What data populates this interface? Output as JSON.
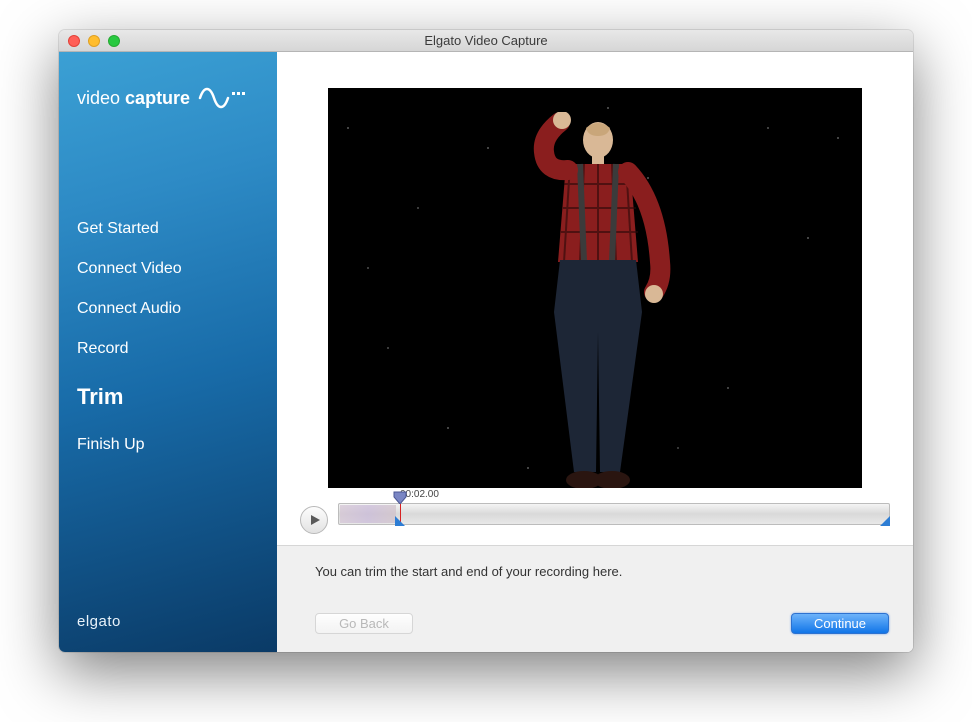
{
  "window": {
    "title": "Elgato Video Capture"
  },
  "logo": {
    "word1": "video",
    "word2": "capture"
  },
  "steps": {
    "s1": "Get Started",
    "s2": "Connect Video",
    "s3": "Connect Audio",
    "s4": "Record",
    "s5": "Trim",
    "s6": "Finish Up",
    "active": "s5"
  },
  "brand": "elgato",
  "timeline": {
    "timecode": "00:02.00"
  },
  "help": "You can trim the start and end of your recording here.",
  "buttons": {
    "back": "Go Back",
    "continue": "Continue"
  }
}
